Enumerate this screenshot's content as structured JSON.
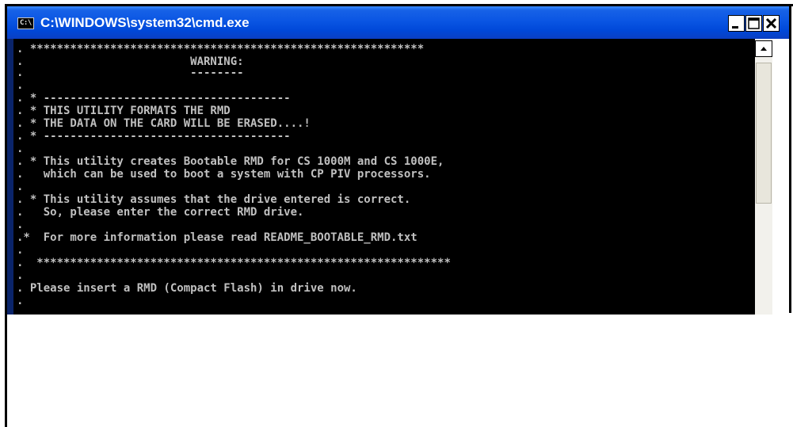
{
  "window": {
    "title": "C:\\WINDOWS\\system32\\cmd.exe",
    "icon_label": "C:\\",
    "buttons": {
      "minimize": "minimize-icon",
      "maximize": "maximize-icon",
      "close": "close-icon"
    }
  },
  "console": {
    "lines": [
      ". ***********************************************************",
      ".                         WARNING:",
      ".                         --------",
      ".",
      ". * -------------------------------------",
      ". * THIS UTILITY FORMATS THE RMD",
      ". * THE DATA ON THE CARD WILL BE ERASED....!",
      ". * -------------------------------------",
      ".",
      ". * This utility creates Bootable RMD for CS 1000M and CS 1000E,",
      ".   which can be used to boot a system with CP PIV processors.",
      ".",
      ". * This utility assumes that the drive entered is correct.",
      ".   So, please enter the correct RMD drive.",
      ".",
      ".*  For more information please read README_BOOTABLE_RMD.txt",
      ".",
      ".  **************************************************************",
      ".",
      ". Please insert a RMD (Compact Flash) in drive now.",
      "."
    ]
  },
  "colors": {
    "titlebar": "#0a55e3",
    "console_bg": "#000000",
    "console_text": "#c0c0c0",
    "frame": "#0a246a"
  }
}
